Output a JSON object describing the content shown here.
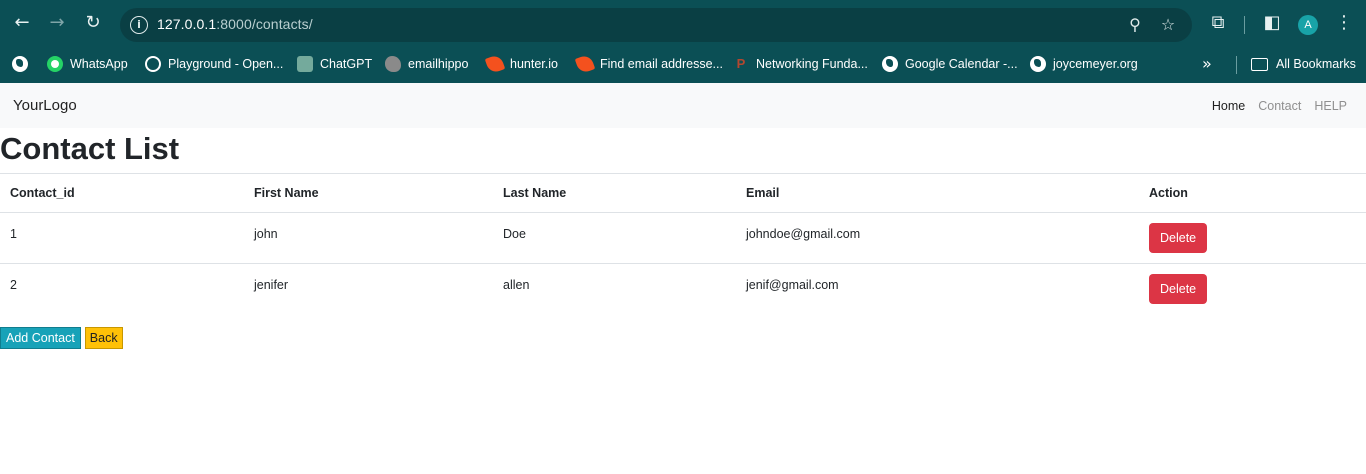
{
  "browser": {
    "url_host": "127.0.0.1",
    "url_rest": ":8000/contacts/",
    "profile_initial": "A",
    "icons": [
      "back-icon",
      "forward-icon",
      "reload-icon",
      "site-info-icon",
      "zoom-icon",
      "star-icon",
      "extensions-icon",
      "side-panel-icon",
      "menu-icon"
    ],
    "bookmarks": [
      {
        "label": "",
        "icon": "globe-icon"
      },
      {
        "label": "WhatsApp",
        "icon": "whatsapp-icon"
      },
      {
        "label": "Playground - Open...",
        "icon": "openai-icon"
      },
      {
        "label": "ChatGPT",
        "icon": "chatgpt-icon"
      },
      {
        "label": "emailhippo",
        "icon": "hippo-icon"
      },
      {
        "label": "hunter.io",
        "icon": "hunter-icon"
      },
      {
        "label": "Find email addresse...",
        "icon": "hunter-icon"
      },
      {
        "label": "Networking Funda...",
        "icon": "p-icon"
      },
      {
        "label": "Google Calendar -...",
        "icon": "globe-icon"
      },
      {
        "label": "joycemeyer.org",
        "icon": "globe-icon"
      }
    ],
    "all_bookmarks_label": "All Bookmarks"
  },
  "navbar": {
    "brand": "YourLogo",
    "links": [
      {
        "label": "Home",
        "active": true
      },
      {
        "label": "Contact",
        "active": false
      },
      {
        "label": "HELP",
        "active": false
      }
    ]
  },
  "page": {
    "title": "Contact List",
    "table": {
      "headers": [
        "Contact_id",
        "First Name",
        "Last Name",
        "Email",
        "Action"
      ],
      "rows": [
        {
          "id": "1",
          "first": "john",
          "last": "Doe",
          "email": "johndoe@gmail.com",
          "action": "Delete"
        },
        {
          "id": "2",
          "first": "jenifer",
          "last": "allen",
          "email": "jenif@gmail.com",
          "action": "Delete"
        }
      ]
    },
    "add_button": "Add Contact",
    "back_button": "Back"
  },
  "colors": {
    "chrome": "#0b4f55",
    "delete": "#dc3545",
    "add": "#17a2b8",
    "back": "#ffc107"
  }
}
